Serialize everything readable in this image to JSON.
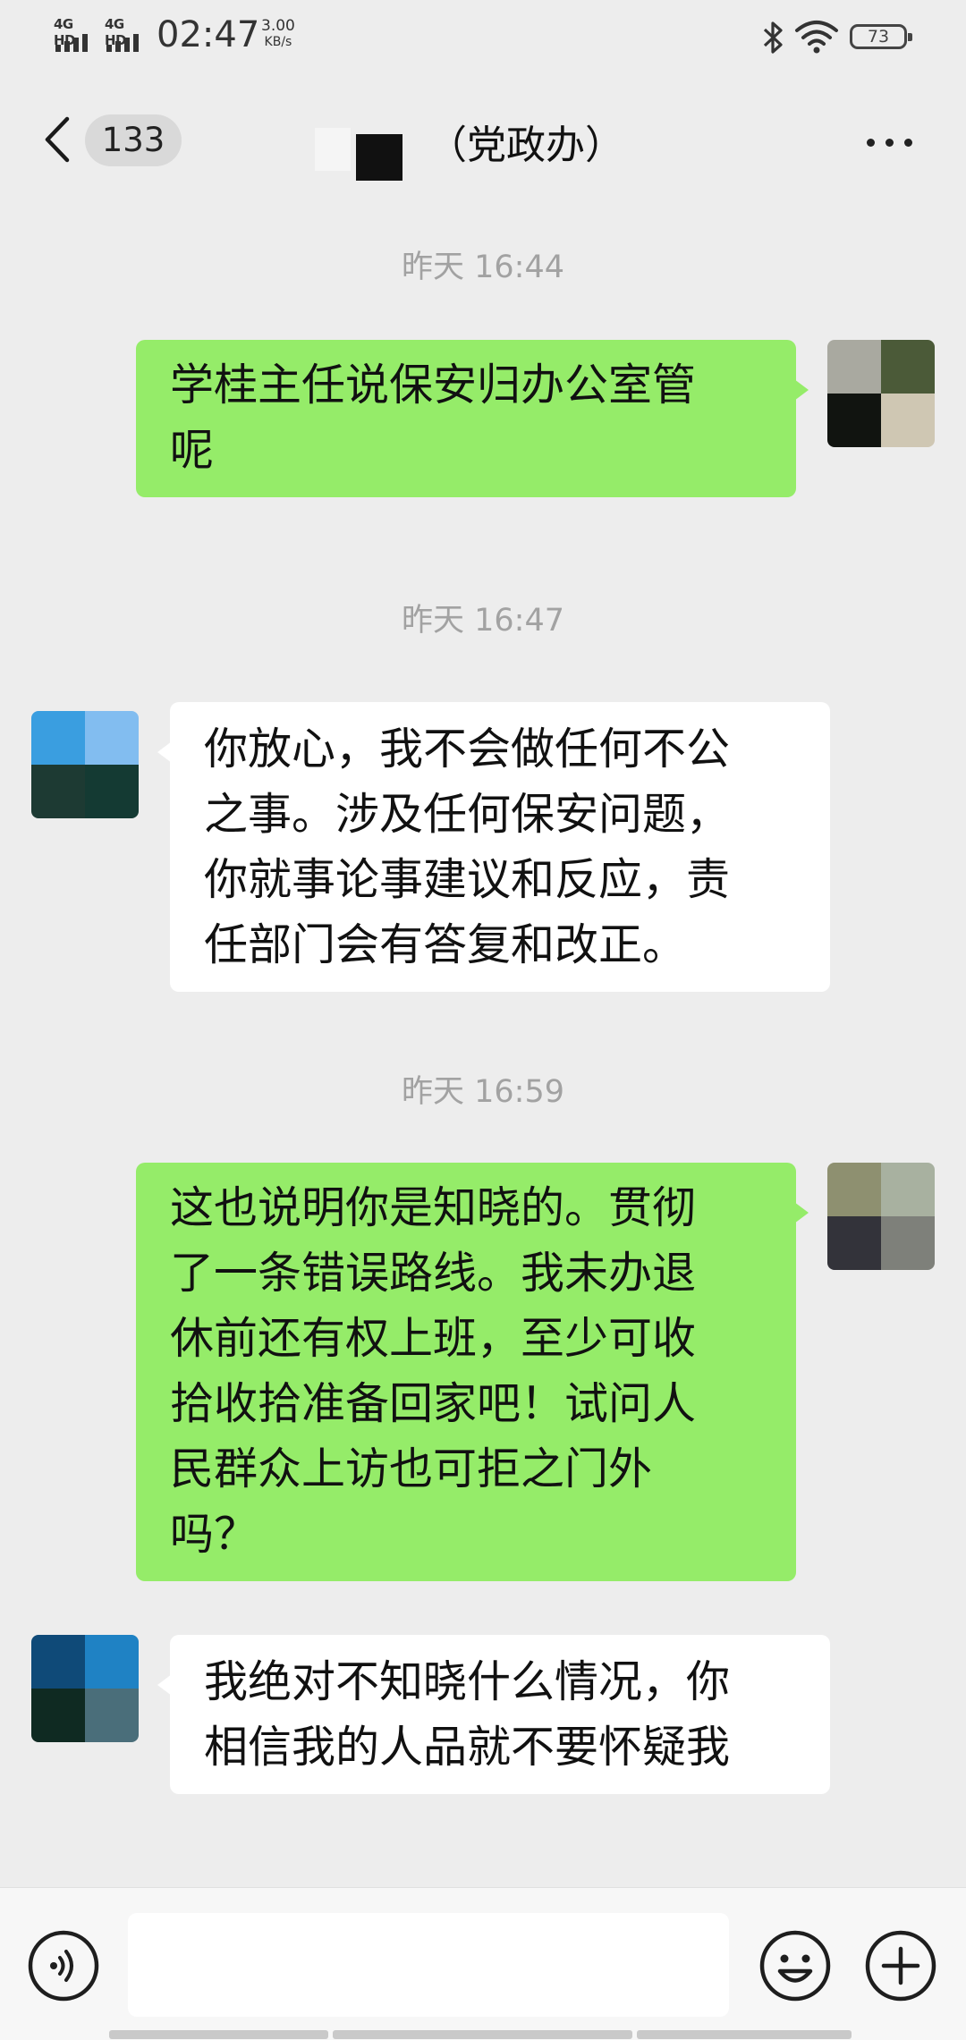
{
  "status_bar": {
    "signal1": "4G HD",
    "signal2": "4G HD",
    "time": "02:47",
    "speed_value": "3.00",
    "speed_unit": "KB/s",
    "battery": "73"
  },
  "header": {
    "back_count": "133",
    "title": "（党政办）"
  },
  "messages": [
    {
      "type": "timestamp",
      "text": "昨天 16:44"
    },
    {
      "type": "outgoing",
      "text": "学桂主任说保安归办公室管\n呢",
      "avatar_colors": [
        "#a9a9a0",
        "#4b5a38",
        "#111410",
        "#cfc7b3"
      ]
    },
    {
      "type": "timestamp",
      "text": "昨天 16:47"
    },
    {
      "type": "incoming",
      "text": "你放心，我不会做任何不公\n之事。涉及任何保安问题，\n你就事论事建议和反应，责\n任部门会有答复和改正。",
      "avatar_colors": [
        "#3a9ee0",
        "#82bdf0",
        "#1d3a33",
        "#143a33"
      ]
    },
    {
      "type": "timestamp",
      "text": "昨天 16:59"
    },
    {
      "type": "outgoing",
      "text": "这也说明你是知晓的。贯彻\n了一条错误路线。我未办退\n休前还有权上班，至少可收\n拾收拾准备回家吧！试问人\n民群众上访也可拒之门外\n吗？",
      "avatar_colors": [
        "#8e9070",
        "#a8b1a0",
        "#33333a",
        "#7e807a"
      ]
    },
    {
      "type": "incoming",
      "text": "我绝对不知晓什么情况，你\n相信我的人品就不要怀疑我",
      "avatar_colors": [
        "#0f4a78",
        "#1f82c4",
        "#0f2a22",
        "#4a6e7a"
      ]
    }
  ],
  "input": {
    "value": "",
    "placeholder": ""
  },
  "colors": {
    "background": "#ededed",
    "outgoing_bubble": "#95ec69",
    "incoming_bubble": "#ffffff",
    "timestamp": "#a2a2a2"
  },
  "icons": {
    "back": "chevron-left-icon",
    "more": "more-horizontal-icon",
    "voice": "voice-icon",
    "emoji": "emoji-icon",
    "plus": "plus-icon",
    "bluetooth": "bluetooth-icon",
    "wifi": "wifi-icon",
    "battery": "battery-icon"
  }
}
